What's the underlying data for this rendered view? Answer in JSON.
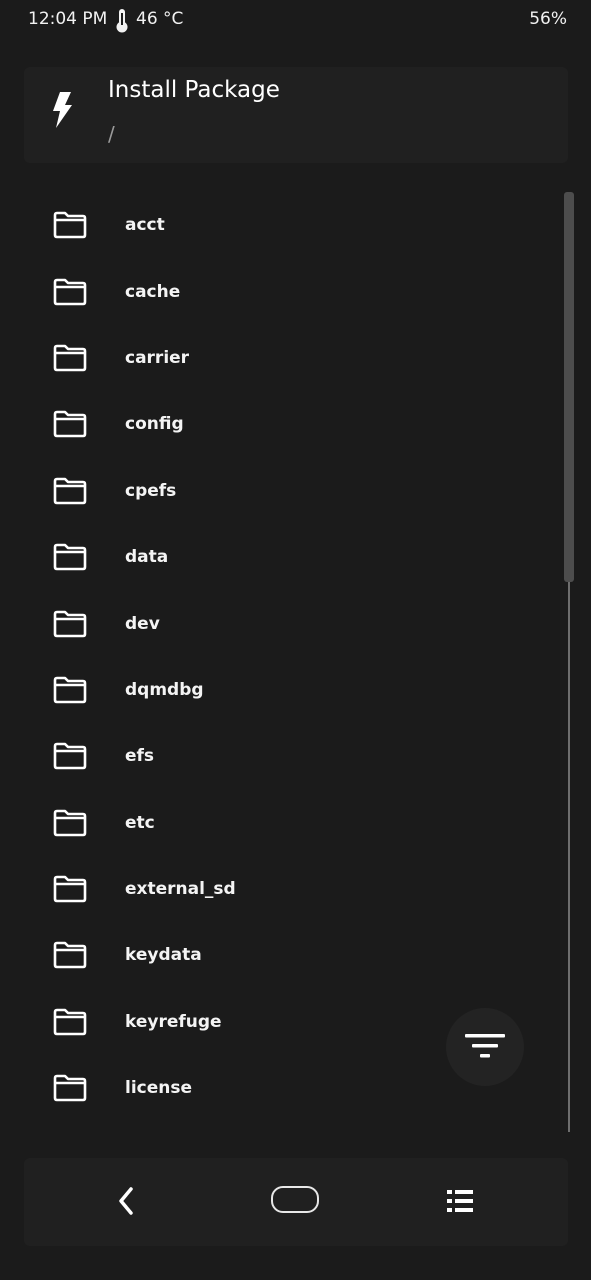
{
  "status_bar": {
    "time": "12:04 PM",
    "temperature": "46 °C",
    "battery": "56%",
    "thermometer_icon": "thermometer-icon"
  },
  "header": {
    "icon": "flash-icon",
    "title": "Install Package",
    "path": "/"
  },
  "files": [
    {
      "name": "acct",
      "icon": "folder-icon"
    },
    {
      "name": "cache",
      "icon": "folder-icon"
    },
    {
      "name": "carrier",
      "icon": "folder-icon"
    },
    {
      "name": "config",
      "icon": "folder-icon"
    },
    {
      "name": "cpefs",
      "icon": "folder-icon"
    },
    {
      "name": "data",
      "icon": "folder-icon"
    },
    {
      "name": "dev",
      "icon": "folder-icon"
    },
    {
      "name": "dqmdbg",
      "icon": "folder-icon"
    },
    {
      "name": "efs",
      "icon": "folder-icon"
    },
    {
      "name": "etc",
      "icon": "folder-icon"
    },
    {
      "name": "external_sd",
      "icon": "folder-icon"
    },
    {
      "name": "keydata",
      "icon": "folder-icon"
    },
    {
      "name": "keyrefuge",
      "icon": "folder-icon"
    },
    {
      "name": "license",
      "icon": "folder-icon"
    }
  ],
  "filter_button": {
    "icon": "filter-icon"
  },
  "nav_bar": {
    "back_icon": "back-icon",
    "home_icon": "home-icon",
    "recents_icon": "recents-icon"
  },
  "colors": {
    "background": "#1b1b1b",
    "card": "#202020",
    "text": "#ffffff",
    "muted": "#9a9a9a"
  }
}
